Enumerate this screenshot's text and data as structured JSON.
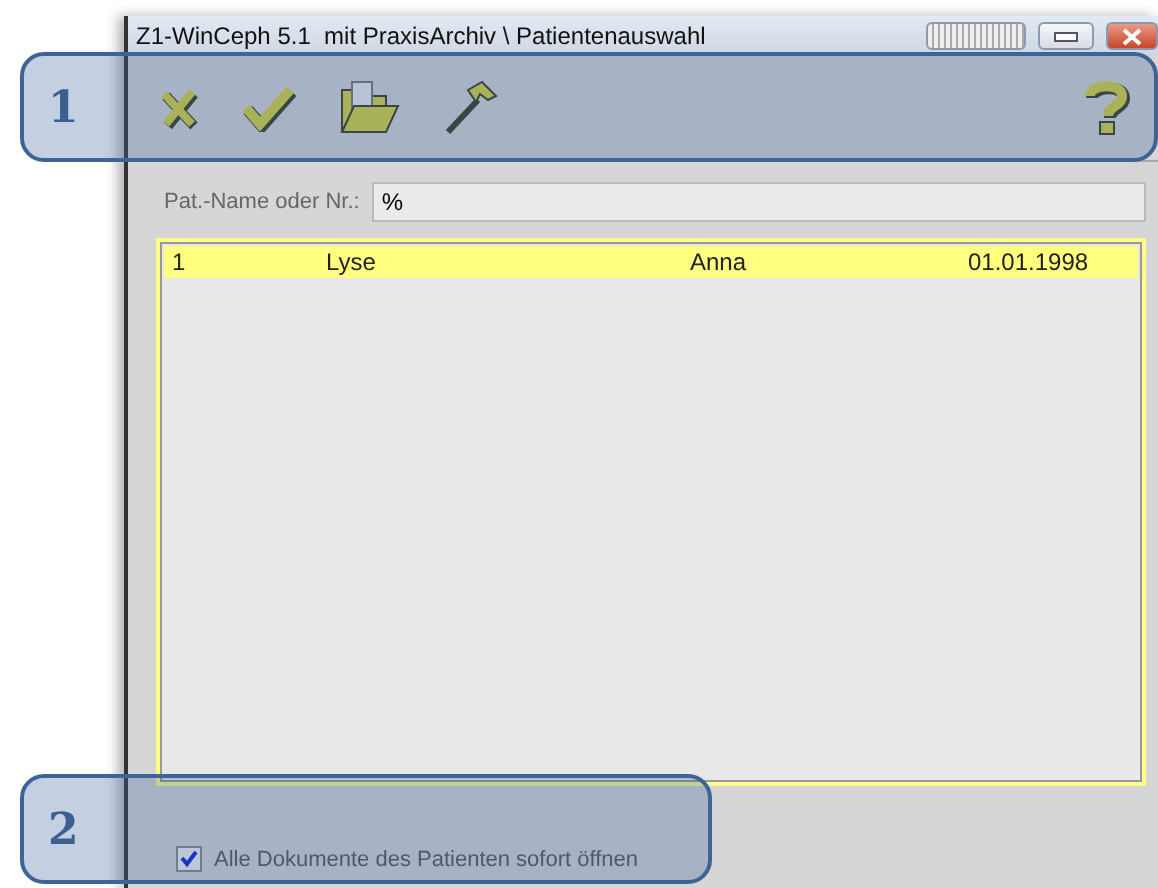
{
  "window": {
    "title": "Z1-WinCeph 5.1  mit PraxisArchiv \\ Patientenauswahl"
  },
  "search": {
    "label": "Pat.-Name oder Nr.:",
    "value": "%"
  },
  "patients": [
    {
      "column_1": "1",
      "column_2": "Lyse",
      "column_3": "Anna",
      "column_4": "01.01.1998",
      "selected": true
    }
  ],
  "option": {
    "label": "Alle Dokumente des Patienten sofort öffnen",
    "checked": true
  },
  "callouts": [
    {
      "label": "1"
    },
    {
      "label": "2"
    }
  ]
}
